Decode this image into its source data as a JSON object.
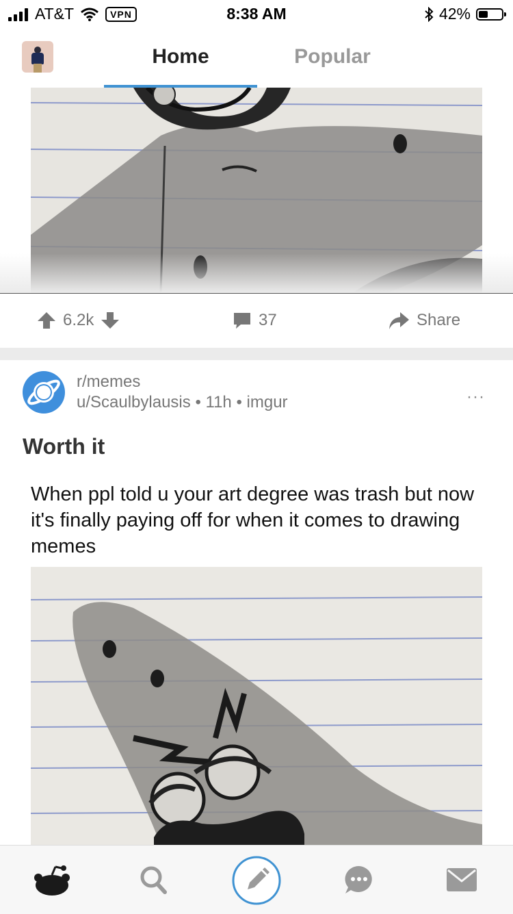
{
  "status": {
    "carrier": "AT&T",
    "vpn": "VPN",
    "time": "8:38 AM",
    "battery": "42%",
    "battery_level": 0.42
  },
  "tabs": {
    "home": "Home",
    "popular": "Popular"
  },
  "prev_post": {
    "votes": "6.2k",
    "comments": "37",
    "share": "Share"
  },
  "post": {
    "subreddit": "r/memes",
    "author": "u/Scaulbylausis",
    "age": "11h",
    "source": "imgur",
    "separator": "•",
    "more": "···",
    "title": "Worth it",
    "caption": "When ppl told u your art degree was trash but now it's finally paying off for when it comes to drawing memes"
  },
  "icons": {
    "signal": "signal-icon",
    "wifi": "wifi-icon",
    "bluetooth": "bluetooth-icon",
    "upvote": "upvote-arrow-icon",
    "downvote": "downvote-arrow-icon",
    "comment": "comment-bubble-icon",
    "share": "share-arrow-icon",
    "home": "reddit-alien-icon",
    "search": "search-icon",
    "compose": "pencil-icon",
    "chat": "chat-bubble-icon",
    "inbox": "mail-envelope-icon"
  },
  "colors": {
    "accent": "#3f92d2",
    "subreddit_icon": "#3f8fdc",
    "muted": "#777777"
  }
}
